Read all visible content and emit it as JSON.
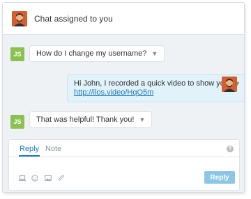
{
  "header": {
    "title": "Chat assigned to you",
    "agent_avatar_icon": "agent-photo-avatar"
  },
  "messages": [
    {
      "direction": "incoming",
      "sender_initials": "JS",
      "text": "How do I change my username?",
      "menu_icon": "chevron-down-icon"
    },
    {
      "direction": "outgoing",
      "text": "Hi John, I recorded a quick video to show you:",
      "link": "http://ilos.video/HqO5m",
      "menu_icon": "chevron-down-icon"
    },
    {
      "direction": "incoming",
      "sender_initials": "JS",
      "text": "That was helpful! Thank you!",
      "menu_icon": "chevron-down-icon"
    }
  ],
  "composer": {
    "tabs": [
      {
        "label": "Reply",
        "active": true
      },
      {
        "label": "Note",
        "active": false
      }
    ],
    "help_icon": "?",
    "tools": [
      "laptop-icon",
      "emoji-icon",
      "image-icon",
      "paperclip-icon"
    ],
    "reply_button_label": "Reply"
  },
  "colors": {
    "accent": "#1e7bbf",
    "reply_button": "#8cc6e6",
    "initials_badge": "#8cc152",
    "outgoing_bubble": "#e1f2fb",
    "panel_background": "#eff2f5"
  }
}
